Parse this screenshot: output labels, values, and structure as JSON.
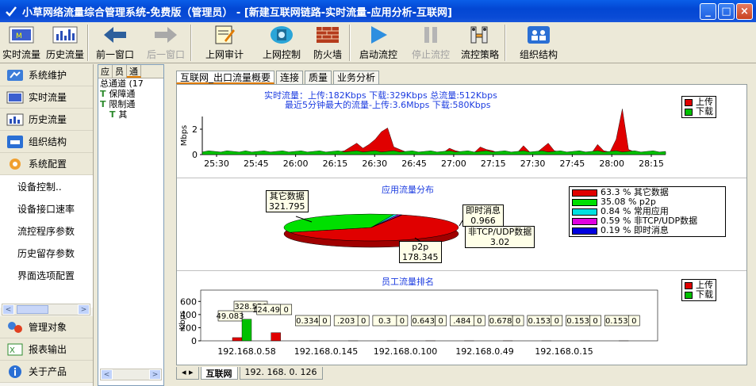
{
  "window": {
    "title": "小草网络流量综合管理系统-免费版（管理员） - [新建互联网链路-实时流量-应用分析-互联网]",
    "min_label": "_",
    "max_label": "□",
    "close_label": "×"
  },
  "toolbar": {
    "items": [
      {
        "label": "实时流量",
        "icon": "realtime-traffic-icon",
        "disabled": false
      },
      {
        "label": "历史流量",
        "icon": "history-traffic-icon",
        "disabled": false
      },
      {
        "label": "前一窗口",
        "icon": "back-arrow-icon",
        "disabled": false
      },
      {
        "label": "后一窗口",
        "icon": "forward-arrow-icon",
        "disabled": true
      },
      {
        "label": "上网审计",
        "icon": "audit-icon",
        "disabled": false
      },
      {
        "label": "上网控制",
        "icon": "control-icon",
        "disabled": false
      },
      {
        "label": "防火墙",
        "icon": "firewall-icon",
        "disabled": false
      },
      {
        "label": "启动流控",
        "icon": "play-icon",
        "disabled": false
      },
      {
        "label": "停止流控",
        "icon": "pause-icon",
        "disabled": true
      },
      {
        "label": "流控策略",
        "icon": "policy-icon",
        "disabled": false
      },
      {
        "label": "组织结构",
        "icon": "org-icon",
        "disabled": false
      }
    ]
  },
  "sidebar": {
    "top_items": [
      {
        "label": "系统维护",
        "icon": "maintenance-icon"
      },
      {
        "label": "实时流量",
        "icon": "realtime-icon"
      },
      {
        "label": "历史流量",
        "icon": "history-icon"
      },
      {
        "label": "组织结构",
        "icon": "org-icon"
      },
      {
        "label": "系统配置",
        "icon": "config-gear-icon"
      }
    ],
    "sub_items": [
      "设备控制..",
      "设备接口速率",
      "流控程序参数",
      "历史留存参数",
      "界面选项配置"
    ],
    "bottom_items": [
      {
        "label": "管理对象",
        "icon": "managed-object-icon"
      },
      {
        "label": "报表输出",
        "icon": "report-icon"
      },
      {
        "label": "关于产品",
        "icon": "about-icon"
      }
    ]
  },
  "tree": {
    "tabs": [
      "应",
      "员",
      "通"
    ],
    "rows": [
      "总通道 (17",
      "保障通",
      "限制通",
      "其"
    ]
  },
  "main": {
    "tabs": [
      "互联网_出口流量概要",
      "连接",
      "质量",
      "业务分析"
    ],
    "bottom_tabs": [
      "互联网",
      "192. 168. 0. 126"
    ]
  },
  "colors": {
    "upload": "#e00000",
    "download": "#00c000"
  },
  "chart_data": [
    {
      "type": "area",
      "subtitle_line1": "实时流量：上传:182Kbps    下载:329Kbps    总流量:512Kbps",
      "subtitle_line2": "最近5分钟最大的流量-上传:3.6Mbps    下载:580Kbps",
      "ylabel": "Mbps",
      "yticks": [
        "0",
        "2"
      ],
      "ylim": [
        0,
        3
      ],
      "xticks": [
        "25:30",
        "25:45",
        "26:00",
        "26:15",
        "26:30",
        "26:45",
        "27:00",
        "27:15",
        "27:30",
        "27:45",
        "28:00",
        "28:15"
      ],
      "legend": [
        "上传",
        "下载"
      ],
      "series": [
        {
          "name": "上传",
          "values": [
            0.2,
            0.1,
            0.15,
            0.1,
            0.2,
            0.15,
            0.1,
            0.2,
            0.1,
            0.15,
            0.1,
            0.2,
            0.1,
            0.15,
            0.1,
            0.2,
            0.1,
            0.15,
            0.2,
            0.1,
            0.15,
            0.1,
            0.2,
            0.3,
            0.6,
            0.9,
            0.5,
            0.8,
            1.2,
            1.8,
            2.1,
            0.6,
            0.4,
            0.2,
            0.1,
            0.15,
            0.1,
            0.2,
            0.1,
            0.15,
            0.5,
            0.3,
            0.2,
            0.1,
            0.15,
            0.6,
            0.4,
            0.3,
            0.1,
            0.2,
            0.1,
            0.15,
            0.7,
            0.2,
            0.1,
            0.5,
            0.9,
            0.3,
            0.2,
            0.1,
            0.15,
            0.3,
            0.2,
            0.1,
            0.8,
            0.3,
            0.2,
            1.2,
            3.6,
            0.4,
            0.2,
            0.1,
            0.15,
            0.2,
            0.1,
            0.2
          ]
        },
        {
          "name": "下载",
          "values": [
            0.2,
            0.3,
            0.25,
            0.2,
            0.3,
            0.25,
            0.2,
            0.3,
            0.2,
            0.25,
            0.3,
            0.2,
            0.25,
            0.3,
            0.2,
            0.25,
            0.3,
            0.2,
            0.25,
            0.3,
            0.2,
            0.25,
            0.3,
            0.2,
            0.25,
            0.3,
            0.2,
            0.25,
            0.3,
            0.2,
            0.25,
            0.3,
            0.2,
            0.25,
            0.3,
            0.2,
            0.25,
            0.3,
            0.2,
            0.25,
            0.3,
            0.2,
            0.25,
            0.3,
            0.2,
            0.25,
            0.3,
            0.2,
            0.25,
            0.3,
            0.2,
            0.25,
            0.3,
            0.2,
            0.25,
            0.3,
            0.2,
            0.25,
            0.3,
            0.2,
            0.25,
            0.3,
            0.2,
            0.25,
            0.3,
            0.2,
            0.25,
            0.3,
            0.2,
            0.25,
            0.3,
            0.2,
            0.25,
            0.3,
            0.2,
            0.25
          ]
        }
      ]
    },
    {
      "type": "pie",
      "title": "应用流量分布",
      "slices": [
        {
          "label": "其它数据",
          "percent": 63.3,
          "value": "321.795",
          "color": "#e00000"
        },
        {
          "label": "p2p",
          "percent": 35.08,
          "value": "178.345",
          "color": "#00e000"
        },
        {
          "label": "常用应用",
          "percent": 0.84,
          "color": "#00e0e0"
        },
        {
          "label": "非TCP/UDP数据",
          "percent": 0.59,
          "value": "3.02",
          "color": "#e000e0"
        },
        {
          "label": "即时消息",
          "percent": 0.19,
          "value": "0.966",
          "color": "#0000e0"
        }
      ],
      "legend": [
        "63.3 % 其它数据",
        "35.08 % p2p",
        "0.84 % 常用应用",
        "0.59 % 非TCP/UDP数据",
        "0.19 % 即时消息"
      ]
    },
    {
      "type": "bar",
      "title": "员工流量排名",
      "ylabel": "Kbps",
      "yticks": [
        "0",
        "200",
        "400",
        "600"
      ],
      "ylim": [
        0,
        700
      ],
      "legend": [
        "上传",
        "下载"
      ],
      "xtick_labels": [
        "192.168.0.58",
        "192.168.0.145",
        "192.168.0.100",
        "192.168.0.49",
        "192.168.0.15"
      ],
      "groups": [
        {
          "upload": 49.083,
          "download": 328.556,
          "upload_label": "49.083",
          "download_label": "328.556"
        },
        {
          "upload": 124.496,
          "download": 0,
          "upload_label": "124.496",
          "download_label": "0"
        },
        {
          "upload": 0.334,
          "download": 0,
          "upload_label": "0.334",
          "download_label": "0"
        },
        {
          "upload": 0.203,
          "download": 0,
          "upload_label": ".203",
          "download_label": "0"
        },
        {
          "upload": 0.3,
          "download": 0,
          "upload_label": "0.3",
          "download_label": "0"
        },
        {
          "upload": 0.643,
          "download": 0,
          "upload_label": "0.643",
          "download_label": "0"
        },
        {
          "upload": 0.484,
          "download": 0,
          "upload_label": ".484",
          "download_label": "0"
        },
        {
          "upload": 0.678,
          "download": 0,
          "upload_label": "0.678",
          "download_label": "0"
        },
        {
          "upload": 0.153,
          "download": 0,
          "upload_label": "0.153",
          "download_label": "0"
        },
        {
          "upload": 0.153,
          "download": 0,
          "upload_label": "0.153",
          "download_label": "0"
        },
        {
          "upload": 0.153,
          "download": 0,
          "upload_label": "0.153",
          "download_label": "0"
        }
      ]
    }
  ]
}
